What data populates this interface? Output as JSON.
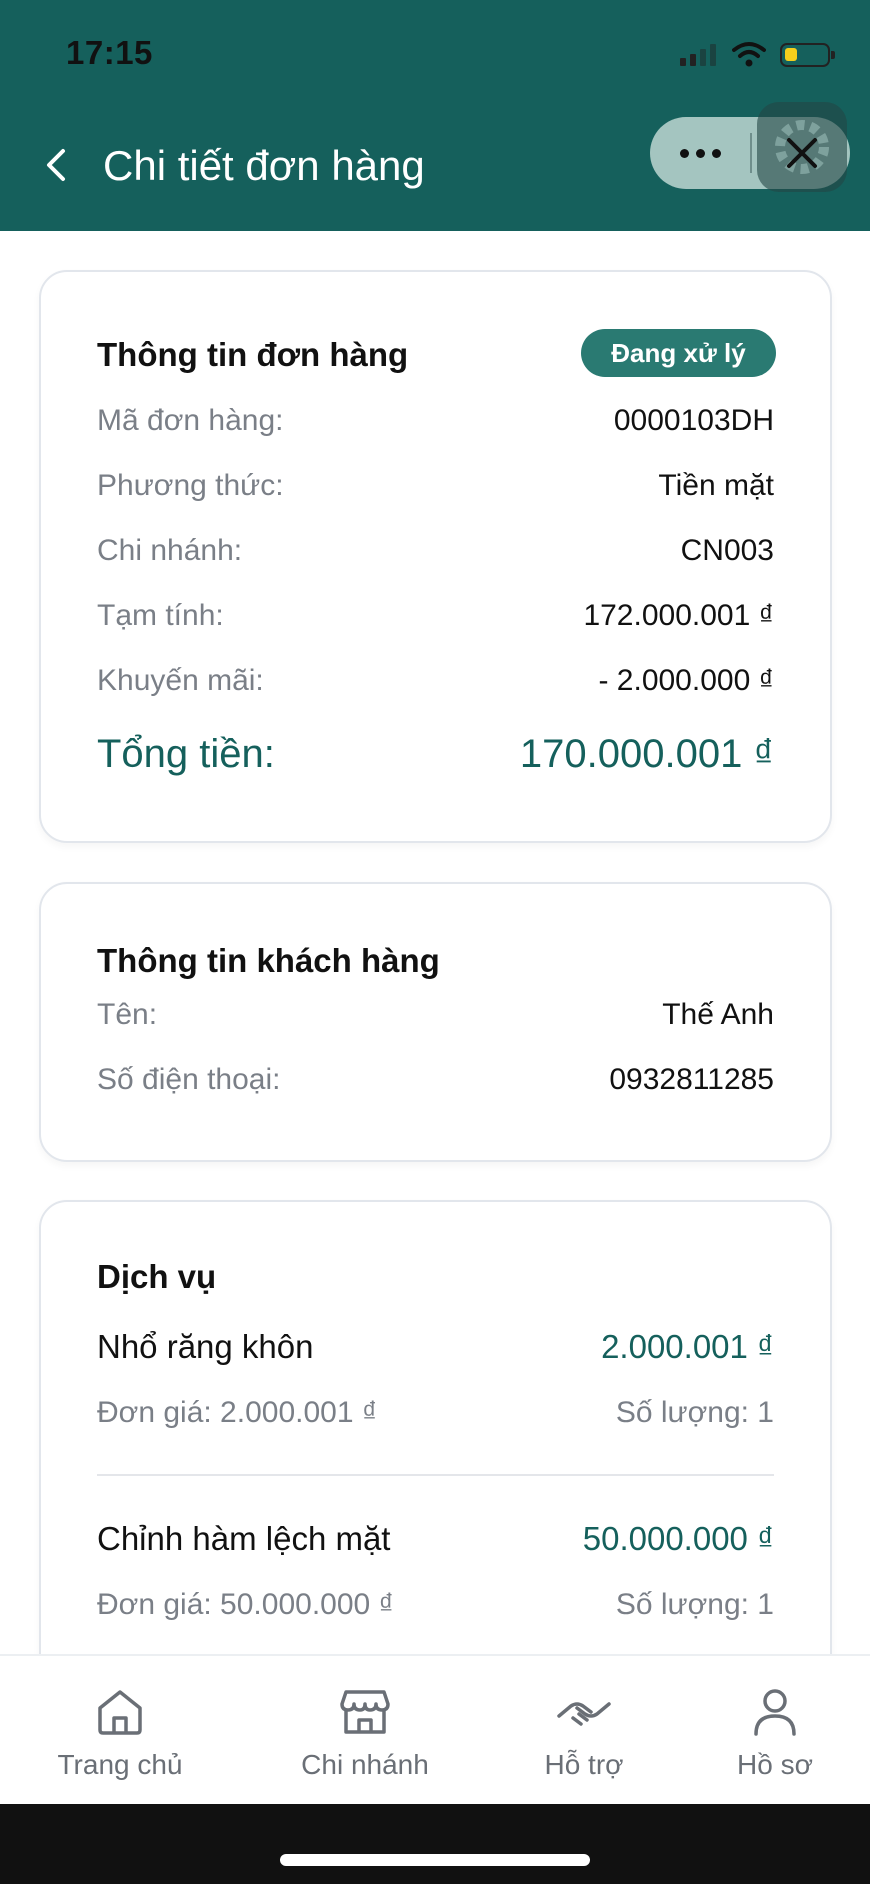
{
  "status_bar": {
    "time": "17:15"
  },
  "header": {
    "title": "Chi tiết đơn hàng"
  },
  "order_info": {
    "title": "Thông tin đơn hàng",
    "status": "Đang xử lý",
    "rows": [
      {
        "label": "Mã đơn hàng:",
        "value": "0000103DH"
      },
      {
        "label": "Phương thức:",
        "value": "Tiền mặt"
      },
      {
        "label": "Chi nhánh:",
        "value": "CN003"
      },
      {
        "label": "Tạm tính:",
        "value": "172.000.001 ₫"
      },
      {
        "label": "Khuyến mãi:",
        "value": "- 2.000.000 ₫"
      }
    ],
    "total_label": "Tổng tiền:",
    "total_value": "170.000.001 ₫"
  },
  "customer_info": {
    "title": "Thông tin khách hàng",
    "rows": [
      {
        "label": "Tên:",
        "value": "Thế Anh"
      },
      {
        "label": "Số điện thoại:",
        "value": "0932811285"
      }
    ]
  },
  "services": {
    "title": "Dịch vụ",
    "items": [
      {
        "name": "Nhổ răng khôn",
        "price": "2.000.001 ₫",
        "unit_price": "Đơn giá: 2.000.001 ₫",
        "quantity": "Số lượng: 1"
      },
      {
        "name": "Chỉnh hàm lệch mặt",
        "price": "50.000.000 ₫",
        "unit_price": "Đơn giá: 50.000.000 ₫",
        "quantity": "Số lượng: 1"
      }
    ]
  },
  "bottom_nav": {
    "items": [
      {
        "label": "Trang chủ",
        "icon": "home-icon"
      },
      {
        "label": "Chi nhánh",
        "icon": "store-icon"
      },
      {
        "label": "Hỗ trợ",
        "icon": "handshake-icon"
      },
      {
        "label": "Hồ sơ",
        "icon": "user-icon"
      }
    ]
  },
  "colors": {
    "header_bg": "#15605c",
    "accent": "#15605c",
    "badge_bg": "#2a7a72"
  }
}
